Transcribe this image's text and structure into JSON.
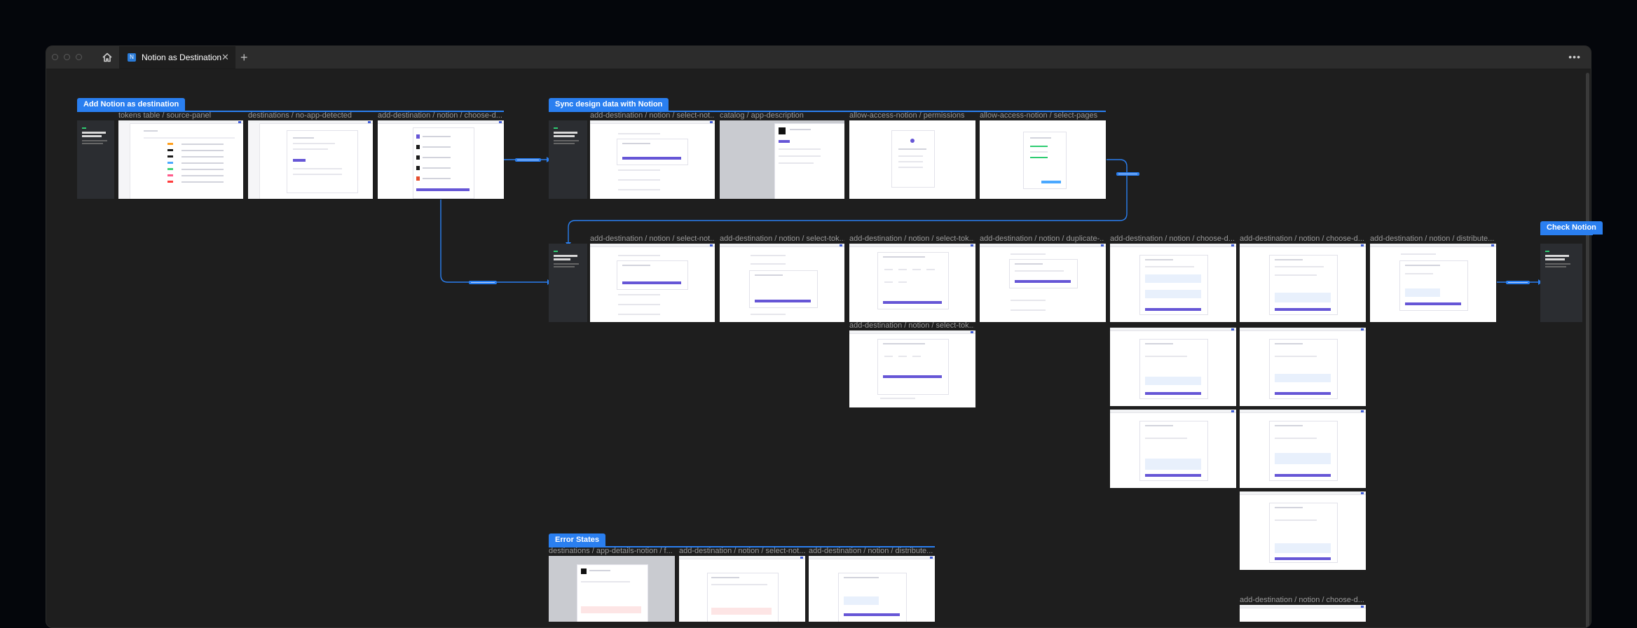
{
  "window": {
    "tab_title": "Notion as Destination",
    "tab_icon": "notion-app-icon",
    "more_icon": "more-horizontal-icon"
  },
  "sections": {
    "add_notion": "Add Notion as destination",
    "sync_design": "Sync design data with Notion",
    "check_notion": "Check Notion",
    "error_states": "Error States"
  },
  "frames": {
    "tokens_table": "tokens table / source-panel",
    "no_app": "destinations / no-app-detected",
    "choose_d1": "add-destination / notion / choose-d...",
    "select_not1": "add-destination / notion / select-not...",
    "app_desc": "catalog / app-description",
    "permissions": "allow-access-notion / permissions",
    "select_pages": "allow-access-notion / select-pages",
    "select_not2": "add-destination / notion / select-not...",
    "select_tok1": "add-destination / notion / select-tok...",
    "select_tok2": "add-destination / notion / select-tok...",
    "duplicate": "add-destination / notion / duplicate-...",
    "choose_d2": "add-destination / notion / choose-d...",
    "choose_d3": "add-destination / notion / choose-d...",
    "distribute1": "add-destination / notion / distribute...",
    "select_tok3": "add-destination / notion / select-tok...",
    "choose_d4": "add-destination / notion / choose-d...",
    "app_details": "destinations / app-details-notion / f...",
    "select_not3": "add-destination / notion / select-not...",
    "distribute2": "add-destination / notion / distribute..."
  },
  "colors": {
    "accent": "#2a7ff0",
    "canvas": "#1e1e1e",
    "frame_button": "#6656d6"
  }
}
